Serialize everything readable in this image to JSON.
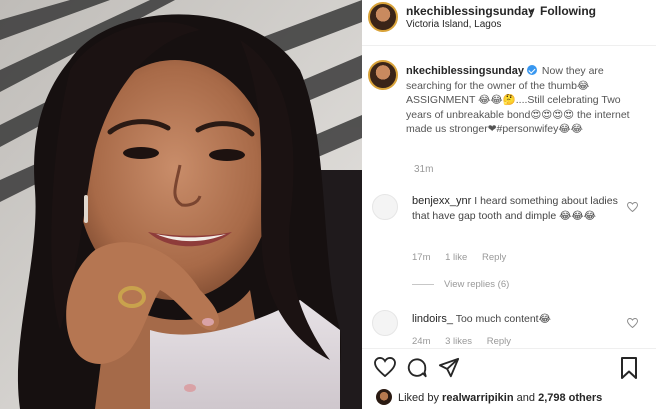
{
  "post": {
    "author": "nkechiblessingsunday",
    "follow_label": "Following",
    "separator": "•",
    "location": "Victoria Island, Lagos"
  },
  "caption": {
    "username": "nkechiblessingsunday",
    "text": "Now they are searching for the owner of the thumb😂 ASSIGNMENT 😂😂🤔....Still celebrating Two years of unbreakable bond😍😍😍😍 the internet made us stronger❤#personwifey😂😂",
    "time": "31m"
  },
  "comments": [
    {
      "username": "benjexx_ynr",
      "text": "I heard something about ladies that have gap tooth and dimple 😂😂😂",
      "time": "17m",
      "likes": "1 like",
      "reply_label": "Reply"
    },
    {
      "username": "lindoirs_",
      "text": "Too much content😂",
      "time": "24m",
      "likes": "3 likes",
      "reply_label": "Reply"
    }
  ],
  "view_replies_label": "View replies (6)",
  "likes": {
    "prefix": "Liked by",
    "user": "realwarripikin",
    "conjunction": "and",
    "others": "2,798 others"
  },
  "icons": {
    "like": "heart-icon",
    "comment": "comment-icon",
    "share": "share-icon",
    "save": "bookmark-icon",
    "verified": "verified-badge-icon",
    "comment_like": "heart-icon"
  },
  "colors": {
    "verified": "#3897f0",
    "text": "#262626",
    "meta": "#999999",
    "avatar_ring": "#d9a33a"
  }
}
